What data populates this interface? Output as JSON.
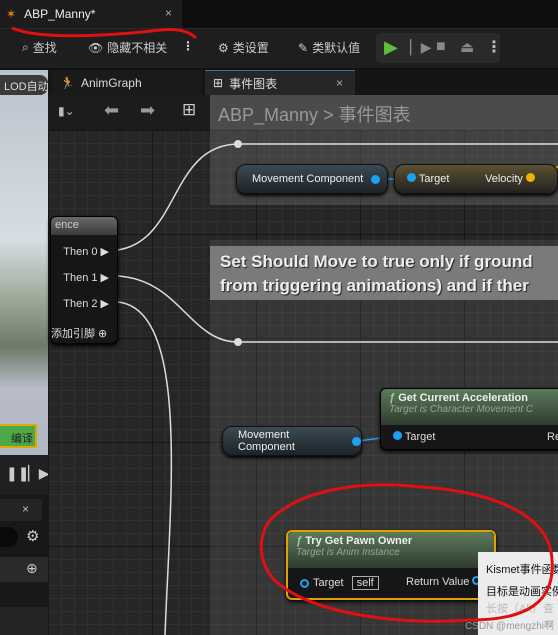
{
  "title_tab": {
    "label": "ABP_Manny*",
    "close": "×"
  },
  "toolbar": {
    "find": "查找",
    "hide_unrelated": "隐藏不相关",
    "class_settings": "类设置",
    "class_defaults": "类默认值"
  },
  "left": {
    "lod": "LOD自动",
    "compile": "编译"
  },
  "graph_tabs": [
    {
      "label": "AnimGraph"
    },
    {
      "label": "事件图表",
      "close": "×"
    }
  ],
  "breadcrumb": {
    "root": "ABP_Manny",
    "sep": ">",
    "current": "事件图表"
  },
  "sequence_node": {
    "title": "ence",
    "outputs": [
      "Then 0",
      "Then 1",
      "Then 2"
    ],
    "add_pin": "添加引脚"
  },
  "comment1": {
    "text_line1": "Set Should Move to true only if ground",
    "text_line2": "from triggering animations) and if ther"
  },
  "nodes": {
    "movement_component_1": "Movement Component",
    "velocity_node": {
      "target": "Target",
      "velocity": "Velocity"
    },
    "movement_component_2": "Movement Component",
    "get_accel": {
      "title": "Get Current Acceleration",
      "subtitle": "Target is Character Movement C",
      "target": "Target",
      "ret": "Re"
    },
    "try_get_pawn": {
      "title": "Try Get Pawn Owner",
      "subtitle": "Target is Anim Instance",
      "target": "Target",
      "self": "self",
      "ret": "Return Value"
    }
  },
  "tooltip": {
    "line1": "Kismet事件函数",
    "line2": "目标是动画实例",
    "line3": "长按（Alt）查"
  },
  "watermark": "CSDN @mengzhi啊",
  "colors": {
    "object_pin": "#1da1f2",
    "vector_pin": "#f0b400",
    "annotation": "#e01010",
    "compile": "#4ea84a"
  }
}
